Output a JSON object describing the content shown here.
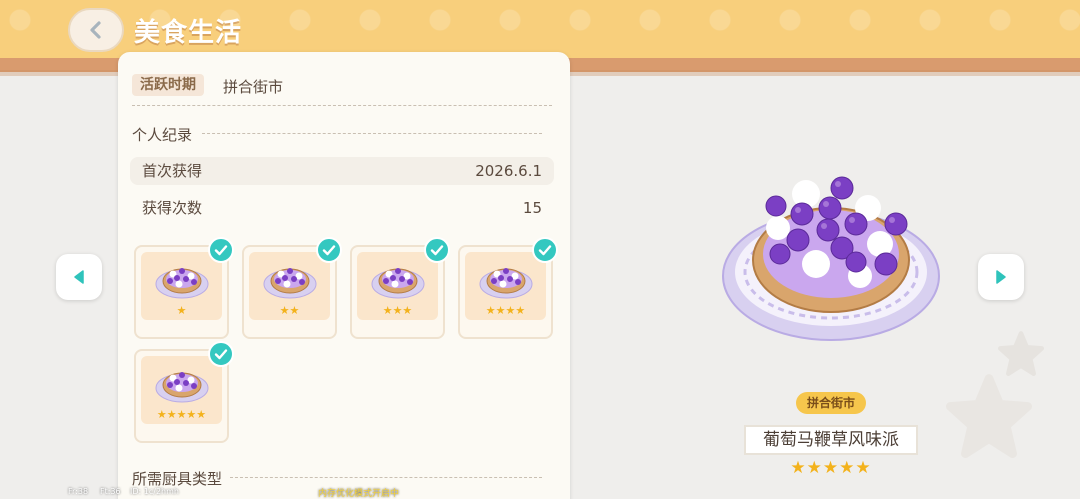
{
  "header": {
    "title": "美食生活"
  },
  "panel": {
    "active_tag": "活跃时期",
    "active_value": "拼合街市",
    "personal_section": "个人纪录",
    "first_obtained_label": "首次获得",
    "first_obtained_value": "2026.6.1",
    "obtain_count_label": "获得次数",
    "obtain_count_value": "15",
    "variants": [
      {
        "stars": "★",
        "star_count": 1,
        "collected": true
      },
      {
        "stars": "★★",
        "star_count": 2,
        "collected": true
      },
      {
        "stars": "★★★",
        "star_count": 3,
        "collected": true
      },
      {
        "stars": "★★★★",
        "star_count": 4,
        "collected": true
      },
      {
        "stars": "★★★★★",
        "star_count": 5,
        "collected": true
      }
    ],
    "tools_section": "所需厨具类型"
  },
  "showcase": {
    "source_badge": "拼合街市",
    "dish_name": "葡萄马鞭草风味派",
    "stars": "★★★★★",
    "star_count": 5
  },
  "debug": {
    "left1": "Fr:38",
    "left2": "Ft:36",
    "left3": "ID: 1c/2hmh",
    "center": "内存优化模式开启中"
  },
  "colors": {
    "header": "#f8cf7c",
    "accent_check": "#34c8c0",
    "star": "#f3b21c",
    "badge": "#f6c64c",
    "tart_purple": "#7b3fc4"
  }
}
